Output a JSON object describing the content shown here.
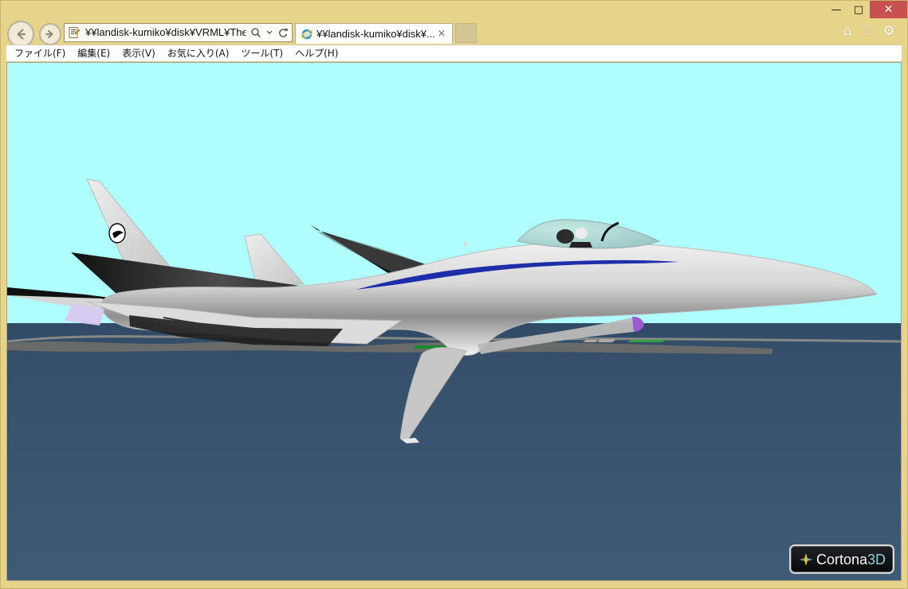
{
  "window": {
    "controls": {
      "minimize_symbol": "—",
      "maximize_symbol": "□",
      "close_symbol": "✕"
    }
  },
  "navigation": {
    "back_icon": "←",
    "forward_icon": "→",
    "address": "¥¥landisk-kumiko¥disk¥VRML¥The ‹",
    "search_icon": "search-icon",
    "dropdown_icon": "chevron-down-icon",
    "refresh_icon": "refresh-icon"
  },
  "tab": {
    "title": "¥¥landisk-kumiko¥disk¥...",
    "close_label": "×"
  },
  "toolbar": {
    "home_icon": "⌂",
    "favorites_icon": "☆",
    "settings_icon": "⚙"
  },
  "menu": {
    "items": [
      "ファイル(F)",
      "編集(E)",
      "表示(V)",
      "お気に入り(A)",
      "ツール(T)",
      "ヘルプ(H)"
    ]
  },
  "viewer": {
    "logo_primary": "Cortona",
    "logo_accent": "3D",
    "colors": {
      "sky": "#afffff",
      "sea": "#3f5d77",
      "aircraft": "#d9d9d9",
      "aircraft_dark": "#222222",
      "stripe": "#1e2ea8",
      "exhaust": "#9b59d6"
    }
  }
}
